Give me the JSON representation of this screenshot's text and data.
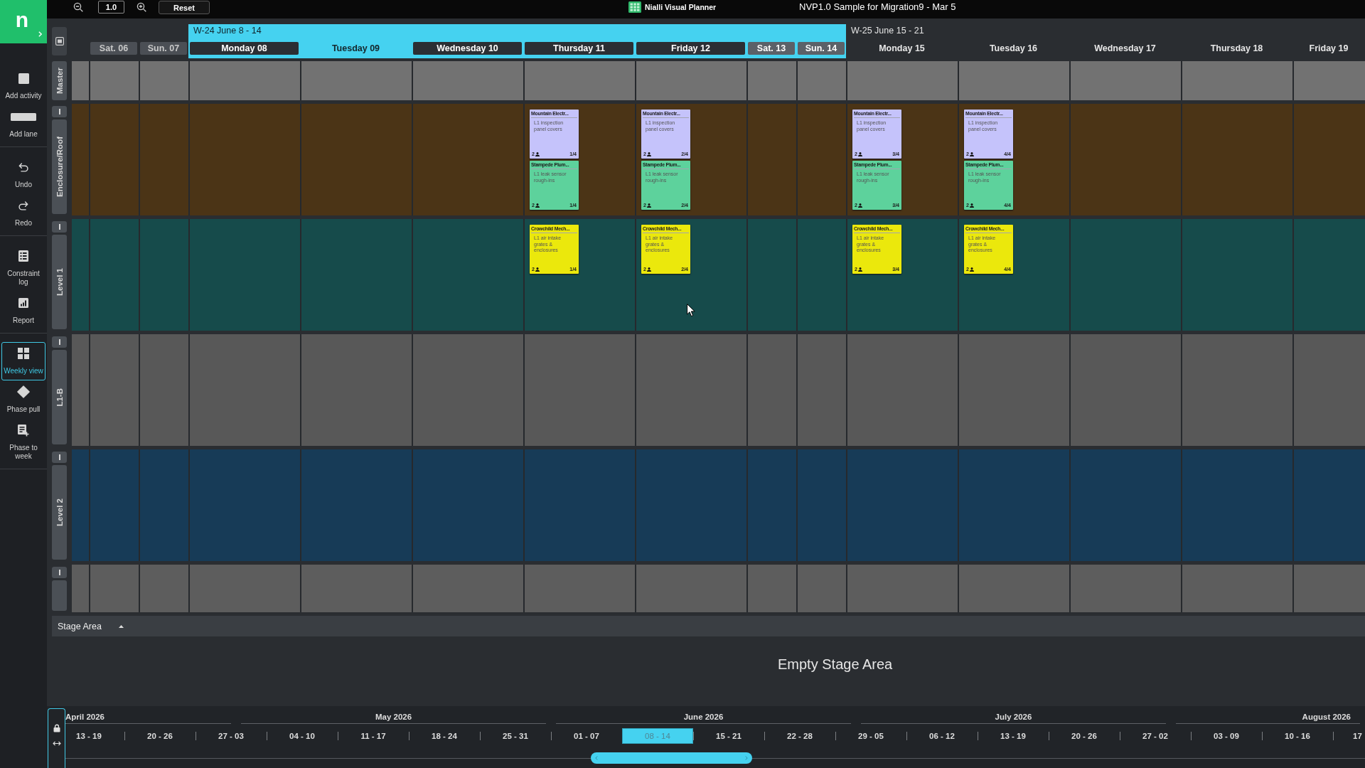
{
  "logo": "n",
  "toolbar": {
    "zoom": "1.0",
    "reset": "Reset",
    "app_name": "Nialli Visual Planner",
    "title": "NVP1.0 Sample for Migration9 - Mar 5"
  },
  "sidebar": {
    "groups": [
      {
        "items": [
          {
            "label": "Add activity",
            "selected": false
          },
          {
            "label": "Add lane",
            "selected": false
          }
        ]
      },
      {
        "items": [
          {
            "label": "Undo",
            "selected": false
          },
          {
            "label": "Redo",
            "selected": false
          }
        ]
      },
      {
        "items": [
          {
            "label": "Constraint log",
            "selected": false
          },
          {
            "label": "Report",
            "selected": false
          }
        ]
      },
      {
        "items": [
          {
            "label": "Weekly view",
            "selected": true
          },
          {
            "label": "Phase pull",
            "selected": false
          },
          {
            "label": "Phase to week",
            "selected": false
          }
        ]
      }
    ]
  },
  "weeks": [
    {
      "selected": false,
      "days": [
        {
          "label": "Sat. 06",
          "kind": "weekend",
          "selected": false
        },
        {
          "label": "Sun. 07",
          "kind": "weekend",
          "selected": false
        }
      ]
    },
    {
      "label": "W-24 June 8 - 14",
      "selected": true,
      "days": [
        {
          "label": "Monday 08",
          "kind": "weekday",
          "selected": false
        },
        {
          "label": "Tuesday 09",
          "kind": "weekday",
          "selected": true
        },
        {
          "label": "Wednesday 10",
          "kind": "weekday",
          "selected": false
        },
        {
          "label": "Thursday 11",
          "kind": "weekday",
          "selected": false
        },
        {
          "label": "Friday 12",
          "kind": "weekday",
          "selected": false
        },
        {
          "label": "Sat. 13",
          "kind": "weekend",
          "selected": false
        },
        {
          "label": "Sun. 14",
          "kind": "weekend",
          "selected": false
        }
      ]
    },
    {
      "label": "W-25 June 15 - 21",
      "selected": false,
      "days": [
        {
          "label": "Monday 15",
          "kind": "weekday",
          "selected": false
        },
        {
          "label": "Tuesday 16",
          "kind": "weekday",
          "selected": false
        },
        {
          "label": "Wednesday 17",
          "kind": "weekday",
          "selected": false
        },
        {
          "label": "Thursday 18",
          "kind": "weekday",
          "selected": false
        },
        {
          "label": "Friday 19",
          "kind": "weekday",
          "selected": false
        }
      ]
    }
  ],
  "lanes": [
    {
      "name": "Master",
      "kind": "master",
      "color": "#727272"
    },
    {
      "name": "Enclosure/Roof",
      "kind": "lane",
      "color": "#4b3416",
      "cells": [
        {},
        {},
        {},
        {},
        {},
        {
          "activities": [
            {
              "company": "Mountain Electr...",
              "task": "L1 inspection panel covers",
              "crew": "2",
              "progress": "1/4",
              "color": "#c5c3fb"
            },
            {
              "company": "Stampede Plum...",
              "task": "L1 leak sensor rough-ins",
              "crew": "2",
              "progress": "1/4",
              "color": "#5dd29c"
            }
          ]
        },
        {
          "activities": [
            {
              "company": "Mountain Electr...",
              "task": "L1 inspection panel covers",
              "crew": "2",
              "progress": "2/4",
              "color": "#c5c3fb"
            },
            {
              "company": "Stampede Plum...",
              "task": "L1 leak sensor rough-ins",
              "crew": "2",
              "progress": "2/4",
              "color": "#5dd29c"
            }
          ]
        },
        {},
        {},
        {
          "activities": [
            {
              "company": "Mountain Electr...",
              "task": "L1 inspection panel covers",
              "crew": "2",
              "progress": "3/4",
              "color": "#c5c3fb"
            },
            {
              "company": "Stampede Plum...",
              "task": "L1 leak sensor rough-ins",
              "crew": "2",
              "progress": "3/4",
              "color": "#5dd29c"
            }
          ]
        },
        {
          "activities": [
            {
              "company": "Mountain Electr...",
              "task": "L1 inspection panel covers",
              "crew": "2",
              "progress": "4/4",
              "color": "#c5c3fb"
            },
            {
              "company": "Stampede Plum...",
              "task": "L1 leak sensor rough-ins",
              "crew": "2",
              "progress": "4/4",
              "color": "#5dd29c"
            }
          ]
        }
      ]
    },
    {
      "name": "Level 1",
      "kind": "lane",
      "color": "#164b4b",
      "cells": [
        {},
        {},
        {},
        {},
        {},
        {
          "activities": [
            {
              "company": "Crowchild Mech...",
              "task": "L1 air intake grates & enclosures",
              "crew": "2",
              "progress": "1/4",
              "color": "#ebe80c"
            }
          ]
        },
        {
          "activities": [
            {
              "company": "Crowchild Mech...",
              "task": "L1 air intake grates & enclosures",
              "crew": "2",
              "progress": "2/4",
              "color": "#ebe80c"
            }
          ]
        },
        {},
        {},
        {
          "activities": [
            {
              "company": "Crowchild Mech...",
              "task": "L1 air intake grates & enclosures",
              "crew": "2",
              "progress": "3/4",
              "color": "#ebe80c"
            }
          ]
        },
        {
          "activities": [
            {
              "company": "Crowchild Mech...",
              "task": "L1 air intake grates & enclosures",
              "crew": "2",
              "progress": "4/4",
              "color": "#ebe80c"
            }
          ]
        }
      ]
    },
    {
      "name": "L1-B",
      "kind": "lane",
      "color": "#585858"
    },
    {
      "name": "Level 2",
      "kind": "lane",
      "color": "#173b57"
    },
    {
      "kind": "lane",
      "color": "#5d5d5d"
    }
  ],
  "stage_area": {
    "title": "Stage Area",
    "message": "Empty Stage Area"
  },
  "timeline": {
    "months": [
      "April 2026",
      "May 2026",
      "June 2026",
      "July 2026",
      "August 2026"
    ],
    "weeks": [
      {
        "label": "13 - 19",
        "selected": false
      },
      {
        "label": "20 - 26",
        "selected": false
      },
      {
        "label": "27 - 03",
        "selected": false
      },
      {
        "label": "04 - 10",
        "selected": false
      },
      {
        "label": "11 - 17",
        "selected": false
      },
      {
        "label": "18 - 24",
        "selected": false
      },
      {
        "label": "25 - 31",
        "selected": false
      },
      {
        "label": "01 - 07",
        "selected": false
      },
      {
        "label": "08 - 14",
        "selected": true
      },
      {
        "label": "15 - 21",
        "selected": false
      },
      {
        "label": "22 - 28",
        "selected": false
      },
      {
        "label": "29 - 05",
        "selected": false
      },
      {
        "label": "06 - 12",
        "selected": false
      },
      {
        "label": "13 - 19",
        "selected": false
      },
      {
        "label": "20 - 26",
        "selected": false
      },
      {
        "label": "27 - 02",
        "selected": false
      },
      {
        "label": "03 - 09",
        "selected": false
      },
      {
        "label": "10 - 16",
        "selected": false
      },
      {
        "label": "17",
        "selected": false
      }
    ]
  }
}
